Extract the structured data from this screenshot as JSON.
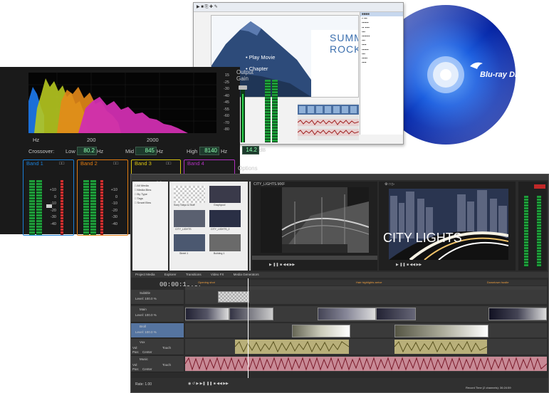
{
  "dvd": {
    "menu_items": [
      "Play Movie",
      "Chapter"
    ],
    "title_line1": "SUMMER",
    "title_line2": "ROCKS"
  },
  "compressor": {
    "output_gain_label": "Output Gain",
    "output_gain_value": "14.2",
    "output_gain_unit": "dB",
    "gain_scale": [
      "15",
      "-25",
      "-30",
      "-40",
      "-45",
      "-55",
      "-60",
      "-70",
      "-80"
    ],
    "freq_axis": [
      "Hz",
      "200",
      "2000"
    ],
    "crossover_label": "Crossover:",
    "low_label": "Low",
    "low_value": "80.2",
    "mid_label": "Mid",
    "mid_value": "845",
    "high_label": "High",
    "high_value": "8140",
    "hz": "Hz",
    "options_label": "Options",
    "bands": [
      "Band 1",
      "Band 2",
      "Band 3",
      "Band 4"
    ],
    "band_scale": [
      "+10",
      "0",
      "-10",
      "-20",
      "-30",
      "-40",
      "-50"
    ],
    "band_colors": [
      "#1a7fd6",
      "#e07a10",
      "#d8c310",
      "#b030c0"
    ]
  },
  "editor": {
    "timecode": "00:00:10:07",
    "tabs": [
      "Project Media",
      "Explorer",
      "Transitions",
      "Video FX",
      "Media Generators"
    ],
    "media_labels": [
      "Sony Tokyo & Stuff",
      "Graphpool",
      "CITY_LIGHTS",
      "CITY_LIGHTS_2",
      "Street 1",
      "Building 1"
    ],
    "preview_title": "CITY LIGHTS",
    "trimmer_label": "CITY_LIGHTS.MXF",
    "markers": [
      "Opening shot",
      "Hair highlights arrive",
      "Downtown hustle"
    ],
    "track_labels": [
      "Subtitle",
      "Main",
      "Broll",
      "Vox",
      "Music"
    ],
    "level_label": "Level: 100.0 %",
    "vol_label": "Vol:",
    "pan_label": "Pan:",
    "center": "Center",
    "touch": "Touch",
    "record_time": "Record Time (2 channels): 36:24:59",
    "rate_label": "Rate: 1.00"
  }
}
